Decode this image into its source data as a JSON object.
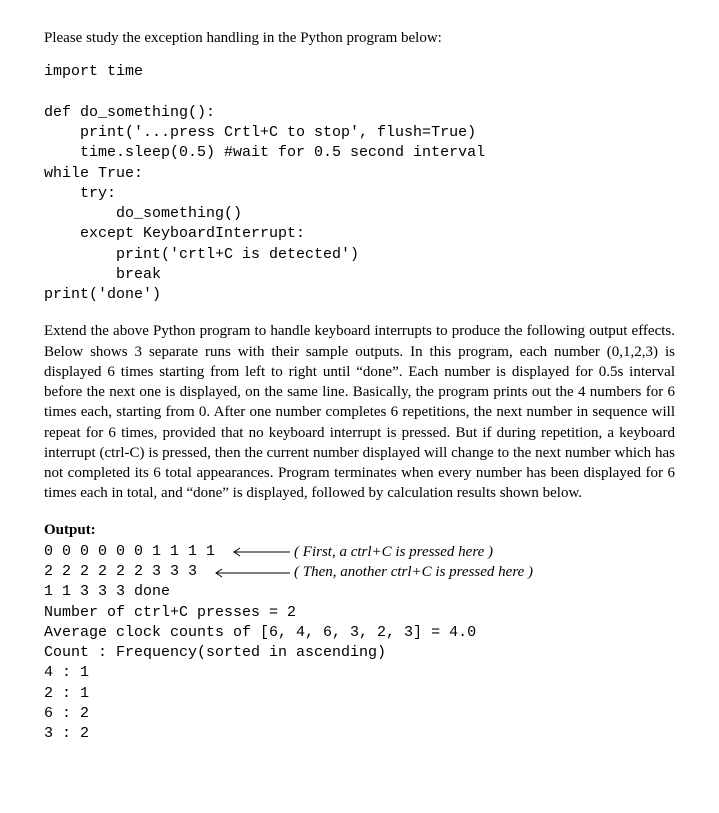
{
  "intro": "Please study the exception handling in the Python program below:",
  "code": {
    "l1": "import time",
    "l2": "",
    "l3": "def do_something():",
    "l4": "    print('...press Crtl+C to stop', flush=True)",
    "l5": "    time.sleep(0.5) #wait for 0.5 second interval",
    "l6": "while True:",
    "l7": "    try:",
    "l8": "        do_something()",
    "l9": "    except KeyboardInterrupt:",
    "l10": "        print('crtl+C is detected')",
    "l11": "        break",
    "l12": "print('done')"
  },
  "explain": "Extend the above Python program to handle keyboard interrupts to produce the following output effects. Below shows 3 separate runs with their sample outputs. In this program, each number (0,1,2,3) is displayed 6 times starting from left to right until “done”. Each number is displayed for 0.5s interval before the next one is displayed, on the same line. Basically, the program prints out the 4 numbers for 6 times each, starting from 0. After one number completes 6 repetitions, the next number in sequence will repeat for 6 times, provided that no keyboard interrupt is pressed. But if during repetition, a keyboard interrupt (ctrl-C) is pressed, then the current number displayed will change to the next number which has not completed its 6 total appearances. Program terminates when every number has been displayed for 6 times each in total, and “done” is displayed, followed by calculation results shown below.",
  "output_heading": "Output:",
  "output": {
    "row1_text": "0 0 0 0 0 0 1 1 1 1 ",
    "row1_note": "( First, a ctrl+C is pressed here )",
    "row2_text": "2 2 2 2 2 2 3 3 3 ",
    "row2_note": "( Then, another ctrl+C is pressed here )",
    "l3": "1 1 3 3 3 done",
    "l4": "Number of ctrl+C presses = 2",
    "l5": "Average clock counts of [6, 4, 6, 3, 2, 3] = 4.0",
    "l6": "Count : Frequency(sorted in ascending)",
    "l7": "4 : 1",
    "l8": "2 : 1",
    "l9": "6 : 2",
    "l10": "3 : 2"
  }
}
